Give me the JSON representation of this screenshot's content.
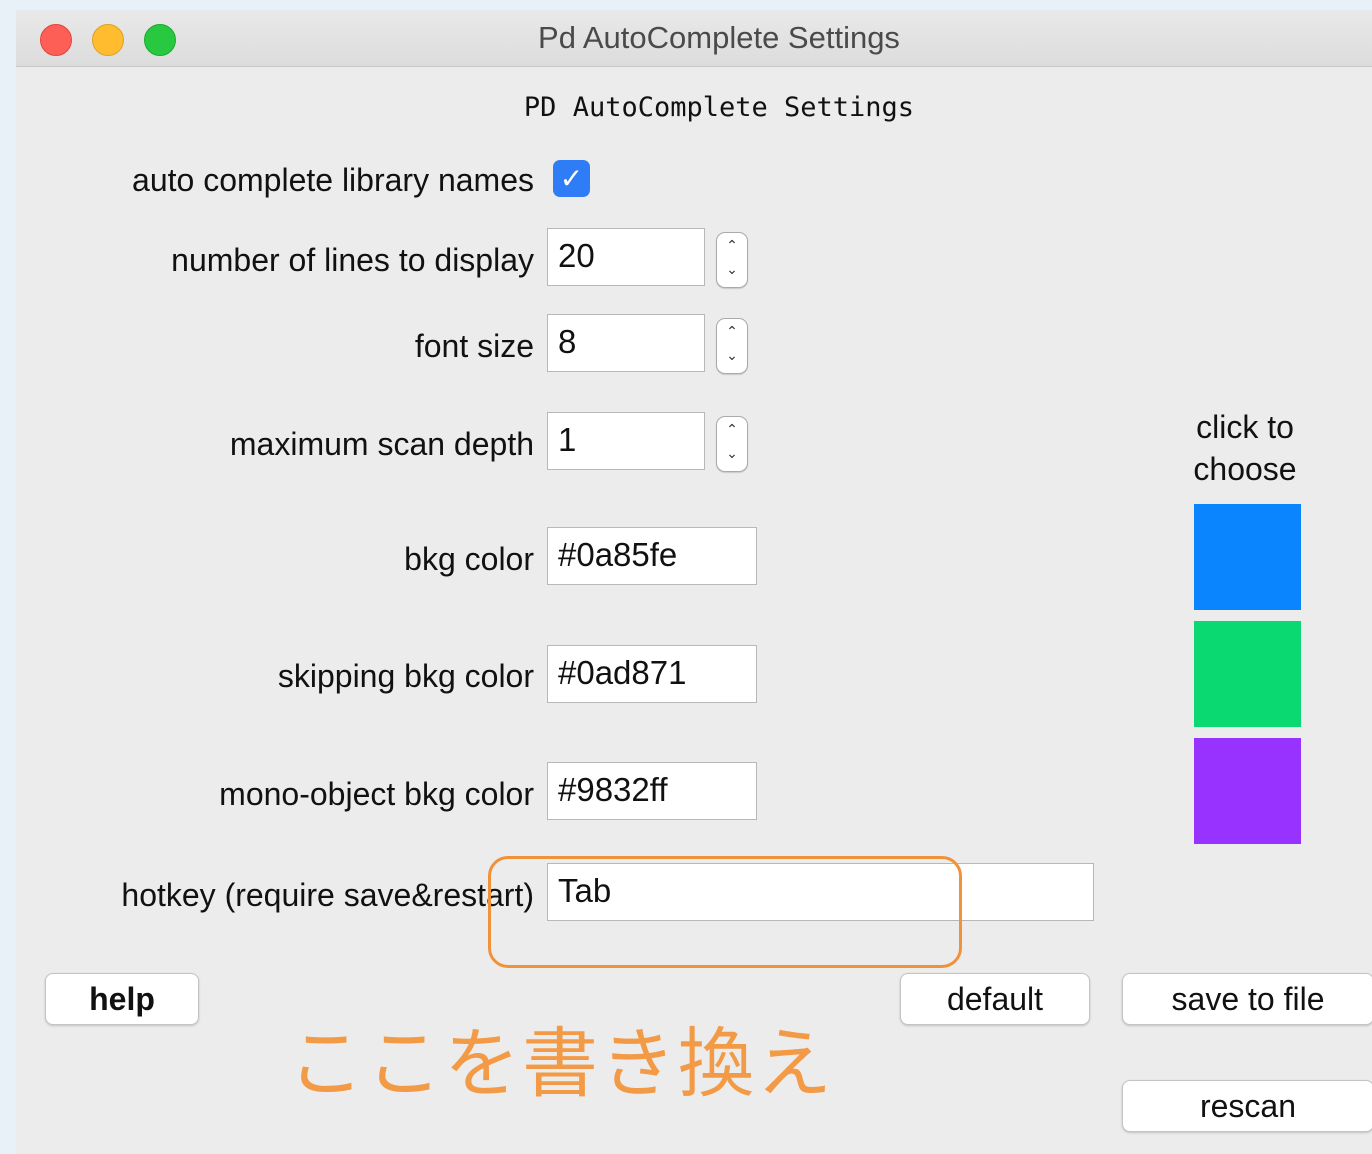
{
  "window": {
    "title": "Pd AutoComplete Settings"
  },
  "heading": "PD AutoComplete Settings",
  "settings": {
    "auto_complete": {
      "label": "auto complete library names",
      "checked": true,
      "check_glyph": "✓"
    },
    "lines": {
      "label": "number of lines to display",
      "value": "20"
    },
    "font_size": {
      "label": "font size",
      "value": "8"
    },
    "scan_depth": {
      "label": "maximum scan depth",
      "value": "1"
    },
    "bkg_color": {
      "label": "bkg color",
      "value": "#0a85fe"
    },
    "skipping_bkg_color": {
      "label": "skipping bkg color",
      "value": "#0ad871"
    },
    "mono_bkg_color": {
      "label": "mono-object bkg color",
      "value": "#9832ff"
    },
    "hotkey": {
      "label": "hotkey (require save&restart)",
      "value": "Tab"
    }
  },
  "stepper": {
    "up": "⌃",
    "down": "⌄"
  },
  "color_picker": {
    "label": "click to choose",
    "swatches": [
      "#0a85fe",
      "#0ad871",
      "#9832ff"
    ]
  },
  "buttons": {
    "help": "help",
    "default": "default",
    "save": "save to file",
    "rescan": "rescan"
  },
  "annotation": {
    "text": "ここを書き換え",
    "color": "#f0923a"
  }
}
